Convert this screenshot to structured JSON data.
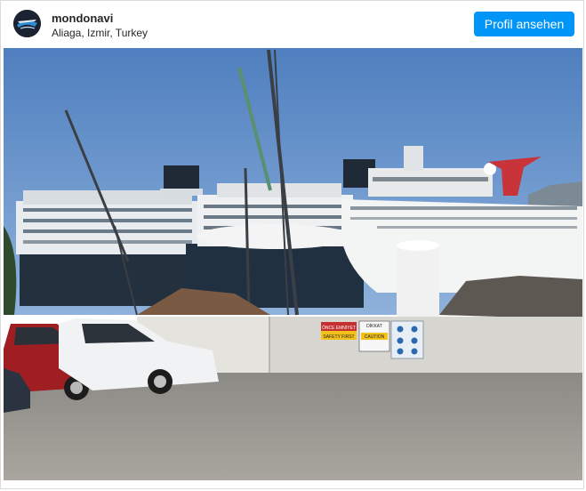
{
  "post": {
    "username": "mondonavi",
    "location": "Aliaga, Izmir, Turkey",
    "follow_label": "Profil ansehen"
  },
  "photo": {
    "signs": {
      "once_emniyet": "ÖNCE EMNİYET",
      "safety_first": "SAFETY FIRST",
      "dikkat": "DİKKAT",
      "caution": "CAUTION"
    }
  },
  "colors": {
    "accent": "#0095f6",
    "sky": "#4f7fbf",
    "funnel_red": "#c8343a"
  }
}
